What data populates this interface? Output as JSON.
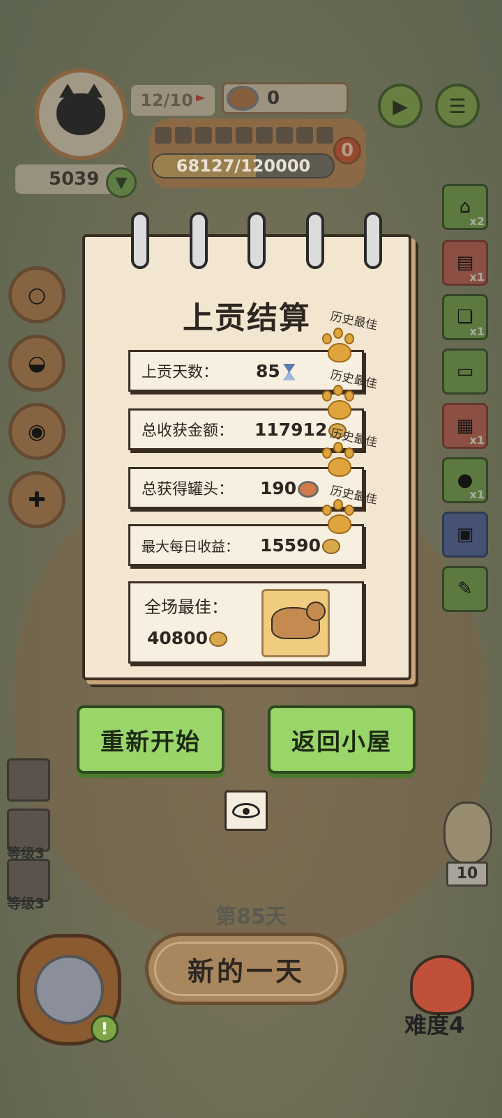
{
  "hud": {
    "tribute_progress": "12/10",
    "cans": "0",
    "coins": "5039",
    "xp": "68127/120000",
    "xp_fraction": 0.568,
    "pending": "0"
  },
  "summary": {
    "title": "上贡结算",
    "best_tag": "历史最佳",
    "rows": [
      {
        "label": "上贡天数：",
        "value": "85"
      },
      {
        "label": "总收获金额：",
        "value": "117912"
      },
      {
        "label": "总获得罐头：",
        "value": "190"
      },
      {
        "label": "最大每日收益：",
        "value": "15590"
      }
    ],
    "best_label": "全场最佳：",
    "best_value": "40800"
  },
  "buttons": {
    "restart": "重新开始",
    "return_home": "返回小屋",
    "new_day": "新的一天"
  },
  "side_counts": {
    "house": "x2",
    "book": "x1",
    "jar": "x1",
    "tray": "x1",
    "mole": "x1"
  },
  "levels": {
    "slot2": "等级3",
    "slot3": "等级3"
  },
  "day": "第85天",
  "owl_count": "10",
  "difficulty": "难度4",
  "alert_icon": "!"
}
